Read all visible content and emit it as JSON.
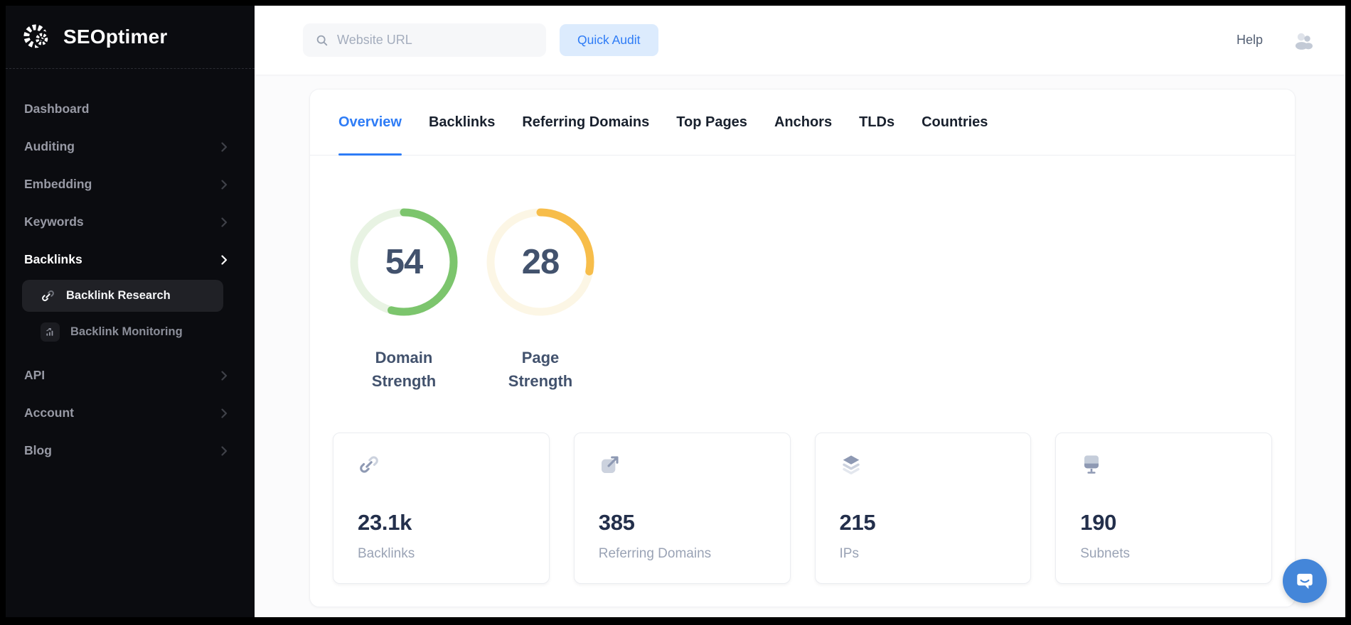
{
  "sidebar": {
    "logo_text": "SEOptimer",
    "items": [
      {
        "label": "Dashboard"
      },
      {
        "label": "Auditing"
      },
      {
        "label": "Embedding"
      },
      {
        "label": "Keywords"
      },
      {
        "label": "Backlinks"
      },
      {
        "label": "API"
      },
      {
        "label": "Account"
      },
      {
        "label": "Blog"
      }
    ],
    "subitems": [
      {
        "label": "Backlink Research",
        "active": true
      },
      {
        "label": "Backlink Monitoring",
        "active": false
      }
    ]
  },
  "topbar": {
    "search_placeholder": "Website URL",
    "quick_audit_label": "Quick Audit",
    "help_label": "Help"
  },
  "tabs": [
    {
      "label": "Overview",
      "active": true
    },
    {
      "label": "Backlinks",
      "active": false
    },
    {
      "label": "Referring Domains",
      "active": false
    },
    {
      "label": "Top Pages",
      "active": false
    },
    {
      "label": "Anchors",
      "active": false
    },
    {
      "label": "TLDs",
      "active": false
    },
    {
      "label": "Countries",
      "active": false
    }
  ],
  "gauges": {
    "items": [
      {
        "value": 54,
        "label": "Domain Strength",
        "color": "#7cc56d",
        "track": "#e8f3e3"
      },
      {
        "value": 28,
        "label": "Page Strength",
        "color": "#f7bd4a",
        "track": "#fcf6e5"
      }
    ]
  },
  "stats": [
    {
      "value": "23.1k",
      "label": "Backlinks",
      "icon": "link-icon"
    },
    {
      "value": "385",
      "label": "Referring Domains",
      "icon": "external-link-icon"
    },
    {
      "value": "215",
      "label": "IPs",
      "icon": "layers-icon"
    },
    {
      "value": "190",
      "label": "Subnets",
      "icon": "monitor-icon"
    }
  ],
  "colors": {
    "accent_blue": "#2e7cf6",
    "gauge_green": "#7cc56d",
    "gauge_orange": "#f7bd4a",
    "chat_button_blue": "#4486d9"
  }
}
